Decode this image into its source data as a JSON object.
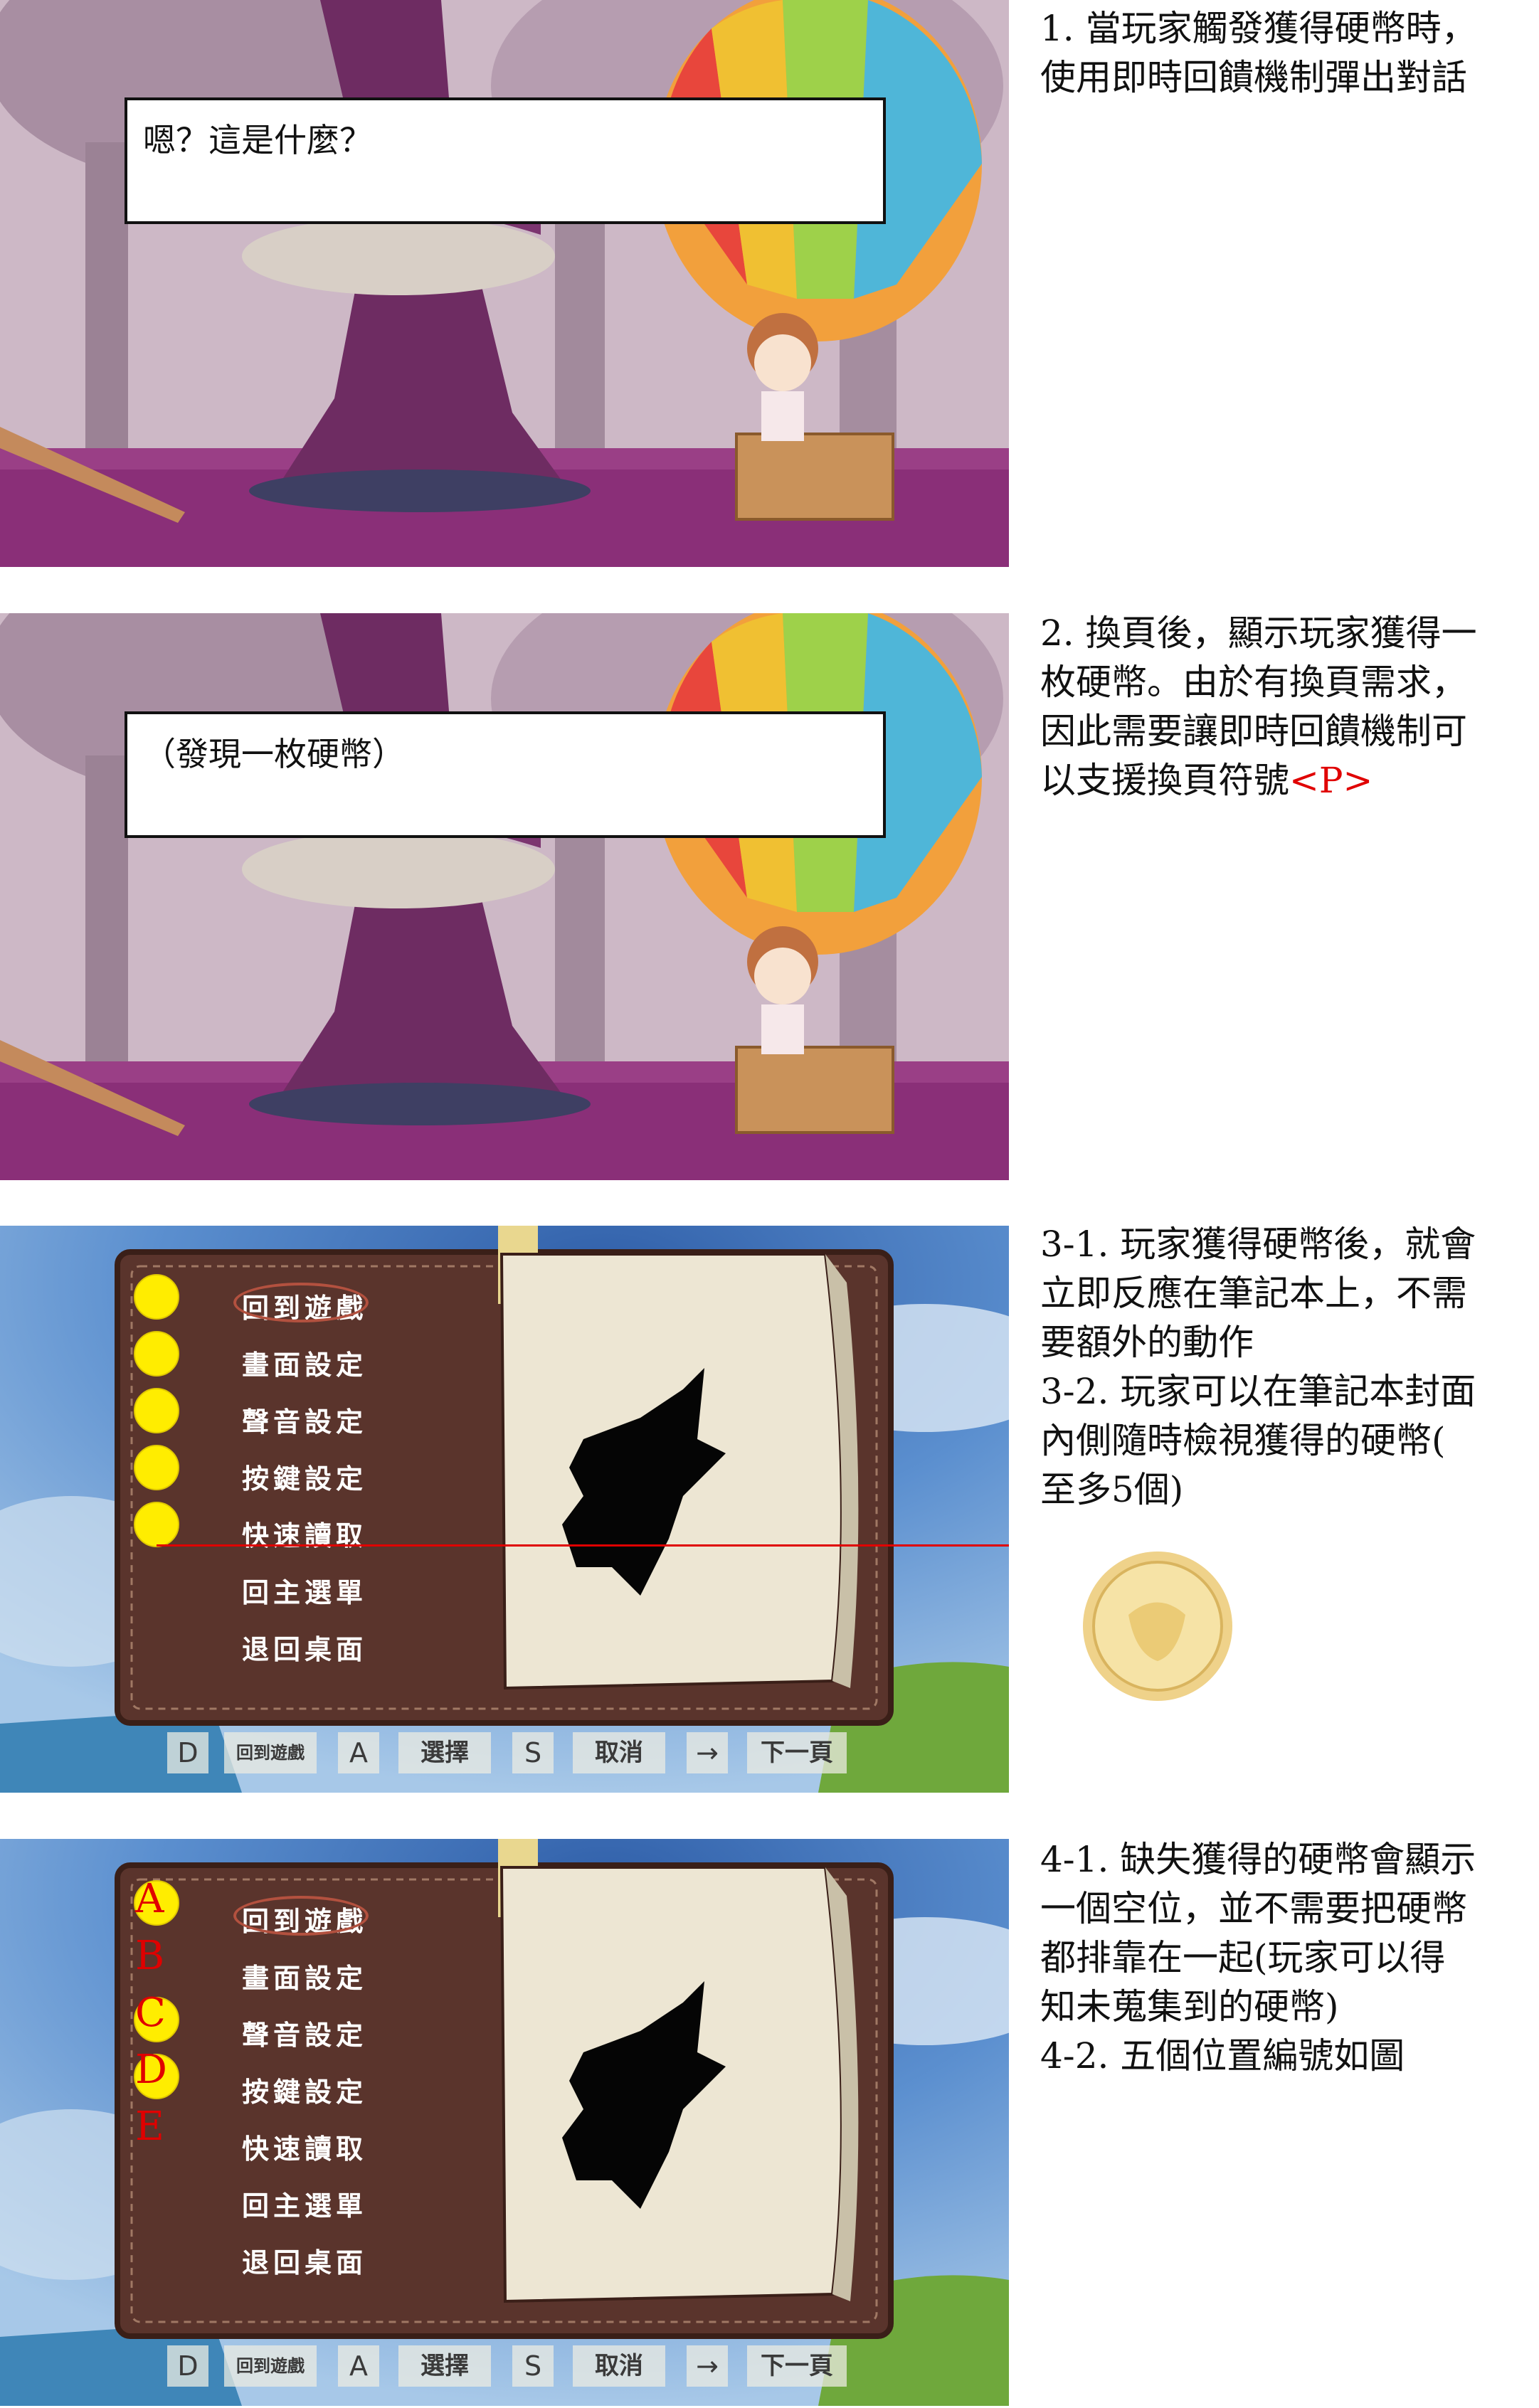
{
  "notes": {
    "step1": [
      "1. 當玩家觸發獲得硬幣時，",
      "使用即時回饋機制彈出對話"
    ],
    "step2": [
      "2. 換頁後，顯示玩家獲得一",
      "枚硬幣。由於有換頁需求，",
      "因此需要讓即時回饋機制可",
      "以支援換頁符號"
    ],
    "step2_tag": "<P>",
    "step3": [
      "3-1. 玩家獲得硬幣後，就會",
      "立即反應在筆記本上，不需",
      "要額外的動作",
      "3-2. 玩家可以在筆記本封面",
      "內側隨時檢視獲得的硬幣(",
      "至多5個)"
    ],
    "step4": [
      "4-1. 缺失獲得的硬幣會顯示",
      "一個空位，並不需要把硬幣",
      "都排靠在一起(玩家可以得",
      "知未蒐集到的硬幣)",
      "4-2. 五個位置編號如圖"
    ]
  },
  "dialog1": "嗯？這是什麼？",
  "dialog2": "（發現一枚硬幣）",
  "menu_items": [
    "回到遊戲",
    "畫面設定",
    "聲音設定",
    "按鍵設定",
    "快速讀取",
    "回主選單",
    "退回桌面"
  ],
  "keybar": {
    "d_key": "D",
    "d_label": "回到遊戲",
    "a_key": "A",
    "a_label": "選擇",
    "s_key": "S",
    "s_label": "取消",
    "arrow_key": "→",
    "arrow_label": "下一頁"
  },
  "slot_labels": [
    "A",
    "B",
    "C",
    "D",
    "E"
  ],
  "colors": {
    "coin": "#ffed00",
    "annotation_red": "#e00000",
    "book_brown": "#5a342c"
  }
}
